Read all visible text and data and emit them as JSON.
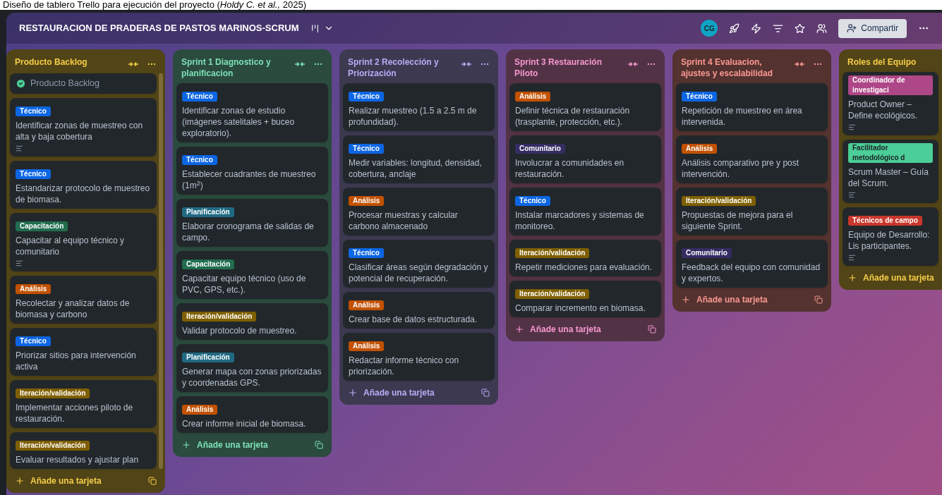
{
  "caption": "Diseño de tablero Trello para ejecución del proyecto (*Holdy C. et al.,* 2025)",
  "header": {
    "title": "RESTAURACION DE PRADERAS DE PASTOS MARINOS-SCRUM",
    "avatar": "CG",
    "share": "Compartir"
  },
  "lists": [
    {
      "title": "Producto Backlog",
      "color": "#f5cd47",
      "actions": true,
      "template": true,
      "scroll": true,
      "add": "Añade una tarjeta",
      "cards": [
        {
          "kind": "status",
          "text": "Producto Backlog",
          "done": true
        },
        {
          "kind": "task",
          "label": {
            "text": "Técnico",
            "color": "#0c66e4"
          },
          "text": "Identificar zonas de muestreo con alta y baja cobertura",
          "description": true
        },
        {
          "kind": "task",
          "label": {
            "text": "Técnico",
            "color": "#0c66e4"
          },
          "text": "Estandarizar protocolo de muestreo de biomasa.",
          "description": false
        },
        {
          "kind": "task",
          "label": {
            "text": "Capacitación",
            "color": "#216e4e"
          },
          "text": "Capacitar al equipo técnico y comunitario",
          "description": true
        },
        {
          "kind": "task",
          "label": {
            "text": "Análisis",
            "color": "#c25100"
          },
          "text": "Recolectar y analizar datos de biomasa y carbono",
          "description": false
        },
        {
          "kind": "task",
          "label": {
            "text": "Técnico",
            "color": "#0c66e4"
          },
          "text": "Priorizar sitios para intervención activa",
          "description": false
        },
        {
          "kind": "task",
          "label": {
            "text": "Iteración/validación",
            "color": "#7f5f01"
          },
          "text": "Implementar acciones piloto de restauración.",
          "description": false
        },
        {
          "kind": "task",
          "label": {
            "text": "Iteración/validación",
            "color": "#7f5f01"
          },
          "text": "Evaluar resultados y ajustar plan",
          "description": false
        }
      ]
    },
    {
      "title": "Sprint 1 Diagnostico y planificacion",
      "color": "#7ee2b8",
      "actions": true,
      "template": true,
      "scroll": false,
      "add": "Añade una tarjeta",
      "cards": [
        {
          "kind": "task",
          "label": {
            "text": "Técnico",
            "color": "#0c66e4"
          },
          "text": "Identificar zonas de estudio (imágenes satelitales + buceo exploratorio).",
          "description": false
        },
        {
          "kind": "task",
          "label": {
            "text": "Técnico",
            "color": "#0c66e4"
          },
          "text": "Establecer cuadrantes de muestreo (1m$^{2}$)",
          "description": false
        },
        {
          "kind": "task",
          "label": {
            "text": "Planificación",
            "color": "#206a83"
          },
          "text": "Elaborar cronograma de salidas de campo.",
          "description": false
        },
        {
          "kind": "task",
          "label": {
            "text": "Capacitación",
            "color": "#216e4e"
          },
          "text": "Capacitar equipo técnico (uso de PVC, GPS, etc.).",
          "description": false
        },
        {
          "kind": "task",
          "label": {
            "text": "Iteración/validación",
            "color": "#7f5f01"
          },
          "text": "Validar protocolo de muestreo.",
          "description": false
        },
        {
          "kind": "task",
          "label": {
            "text": "Planificación",
            "color": "#206a83"
          },
          "text": "Generar mapa con zonas priorizadas y coordenadas GPS.",
          "description": false
        },
        {
          "kind": "task",
          "label": {
            "text": "Análisis",
            "color": "#c25100"
          },
          "text": "Crear informe inicial de biomasa.",
          "description": false
        }
      ]
    },
    {
      "title": "Sprint 2 Recolección y Priorización",
      "color": "#b8acf6",
      "actions": true,
      "template": true,
      "scroll": false,
      "add": "Añade una tarjeta",
      "cards": [
        {
          "kind": "task",
          "label": {
            "text": "Técnico",
            "color": "#0c66e4"
          },
          "text": "Realizar muestreo (1.5 a 2.5 m de profundidad).",
          "description": false
        },
        {
          "kind": "task",
          "label": {
            "text": "Técnico",
            "color": "#0c66e4"
          },
          "text": "Medir variables: longitud, densidad, cobertura, anclaje",
          "description": false
        },
        {
          "kind": "task",
          "label": {
            "text": "Análisis",
            "color": "#c25100"
          },
          "text": "Procesar muestras y calcular carbono almacenado",
          "description": false
        },
        {
          "kind": "task",
          "label": {
            "text": "Técnico",
            "color": "#0c66e4"
          },
          "text": "Clasificar áreas según degradación y potencial de recuperación.",
          "description": false
        },
        {
          "kind": "task",
          "label": {
            "text": "Análisis",
            "color": "#c25100"
          },
          "text": "Crear base de datos estructurada.",
          "description": false
        },
        {
          "kind": "task",
          "label": {
            "text": "Análisis",
            "color": "#c25100"
          },
          "text": "Redactar informe técnico con priorización.",
          "description": false
        }
      ]
    },
    {
      "title": "Sprint 3 Restauración Piloto",
      "color": "#f797d2",
      "actions": true,
      "template": true,
      "scroll": false,
      "add": "Añade una tarjeta",
      "cards": [
        {
          "kind": "task",
          "label": {
            "text": "Análisis",
            "color": "#c25100"
          },
          "text": "Definir técnica de restauración (trasplante, protección, etc.).",
          "description": false
        },
        {
          "kind": "task",
          "label": {
            "text": "Comunitario",
            "color": "#352c63"
          },
          "text": "Involucrar a comunidades en restauración.",
          "description": false
        },
        {
          "kind": "task",
          "label": {
            "text": "Técnico",
            "color": "#0c66e4"
          },
          "text": "Instalar marcadores y sistemas de monitoreo.",
          "description": false
        },
        {
          "kind": "task",
          "label": {
            "text": "Iteración/validación",
            "color": "#7f5f01"
          },
          "text": "Repetir mediciones para evaluación.",
          "description": false
        },
        {
          "kind": "task",
          "label": {
            "text": "Iteración/validación",
            "color": "#7f5f01"
          },
          "text": "Comparar incremento en biomasa.",
          "description": false
        }
      ]
    },
    {
      "title": "Sprint 4 Evaluacion, ajustes y escalabilidad",
      "color": "#fd9891",
      "actions": true,
      "template": true,
      "scroll": false,
      "add": "Añade una tarjeta",
      "cards": [
        {
          "kind": "task",
          "label": {
            "text": "Técnico",
            "color": "#0c66e4"
          },
          "text": "Repetición de muestreo en área intervenida.",
          "description": false
        },
        {
          "kind": "task",
          "label": {
            "text": "Análisis",
            "color": "#c25100"
          },
          "text": "Análisis comparativo pre y post intervención.",
          "description": false
        },
        {
          "kind": "task",
          "label": {
            "text": "Iteración/validación",
            "color": "#7f5f01"
          },
          "text": "Propuestas de mejora para el siguiente Sprint.",
          "description": false
        },
        {
          "kind": "task",
          "label": {
            "text": "Comunitario",
            "color": "#352c63"
          },
          "text": "Feedback del equipo con comunidad y expertos.",
          "description": false
        }
      ]
    },
    {
      "title": "Roles del Equipo",
      "color": "#f5cd47",
      "actions": false,
      "template": false,
      "scroll": false,
      "add": "Añade una tarjeta",
      "cards": [
        {
          "kind": "task",
          "label": {
            "text": "Coordinador de investigaci",
            "color": "#ae4787"
          },
          "text": "Product Owner – Define ecológicos.",
          "description": true
        },
        {
          "kind": "task",
          "label": {
            "text": "Facilitador metodológico d",
            "color": "#4bce97"
          },
          "text": "Scrum Master – Guía del Scrum.",
          "description": true
        },
        {
          "kind": "task",
          "label": {
            "text": "Técnicos de campo",
            "color": "#c9372c"
          },
          "text": "Equipo de Desarrollo: Lis participantes.",
          "description": true
        }
      ]
    }
  ]
}
